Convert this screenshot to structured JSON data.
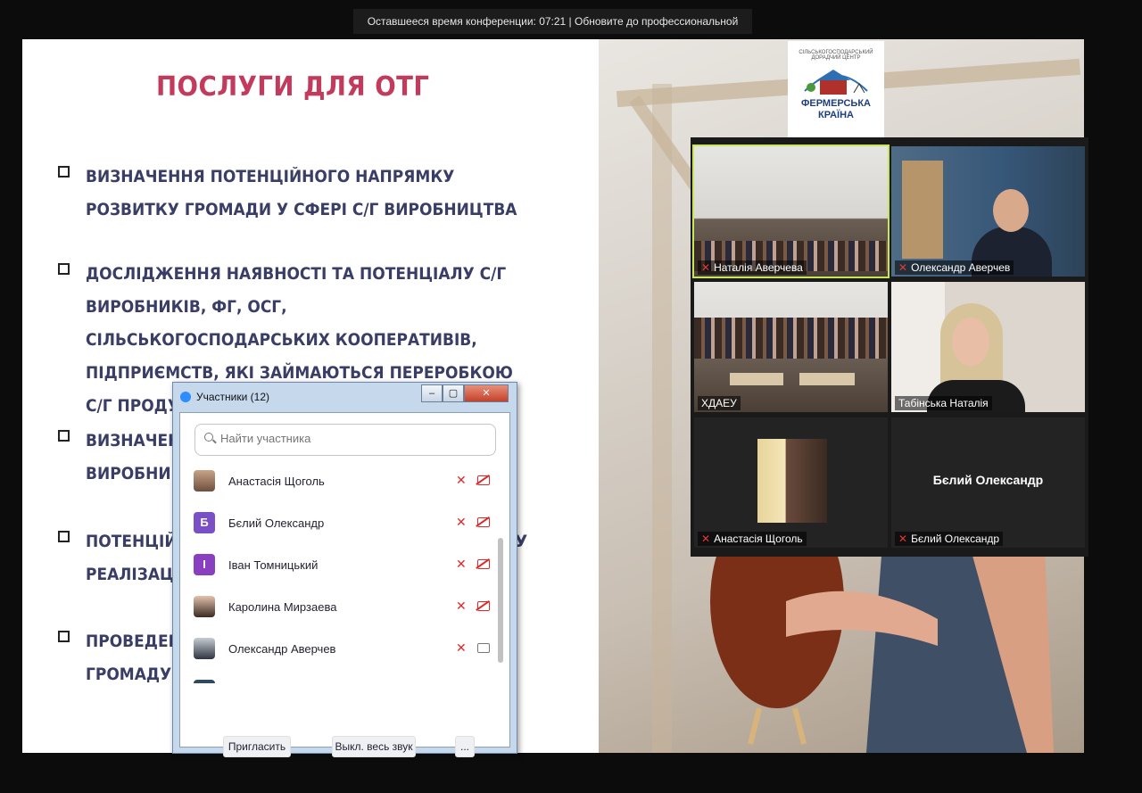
{
  "banner": "Оставшееся время конференции: 07:21 | Обновите до профессиональной версии",
  "slide": {
    "title": "ПОСЛУГИ ДЛЯ ОТГ",
    "bullets": [
      "ВИЗНАЧЕННЯ ПОТЕНЦІЙНОГО НАПРЯМКУ РОЗВИТКУ ГРОМАДИ У СФЕРІ С/Г ВИРОБНИЦТВА",
      "ДОСЛІДЖЕННЯ НАЯВНОСТІ ТА ПОТЕНЦІАЛУ С/Г ВИРОБНИКІВ, ФГ, ОСГ, СІЛЬСЬКОГОСПОДАРСЬКИХ КООПЕРАТИВІВ, ПІДПРИЄМСТВ, ЯКІ ЗАЙМАЮТЬСЯ ПЕРЕРОБКОЮ С/Г ПРОДУКЦІЇ, І Т.Д",
      "ВИЗНАЧЕН",
      "ВИРОБНИК",
      "ПОТЕНЦІЙ",
      "У",
      "РЕАЛІЗАЦІ",
      "ПРОВЕДЕН",
      "ГРОМАДУ Н"
    ],
    "logo": {
      "top_text": "СІЛЬСЬКОГОСПОДАРСЬКИЙ ДОРАДЧИЙ ЦЕНТР",
      "line1": "ФЕРМЕРСЬКА",
      "line2": "КРАЇНА"
    }
  },
  "video_tiles": [
    {
      "name": "Наталія Аверчева"
    },
    {
      "name": "Олександр Аверчев"
    },
    {
      "name": "ХДАЕУ"
    },
    {
      "name": "Табінська Наталія"
    },
    {
      "name": "Анастасія Щоголь"
    },
    {
      "name": "Бєлий Олександр",
      "center_name": "Бєлий Олександр"
    }
  ],
  "participants": {
    "title": "Участники (12)",
    "search_placeholder": "Найти участника",
    "items": [
      {
        "name": "Анастасія Щоголь",
        "initial": "",
        "camera_on": false
      },
      {
        "name": "Бєлий Олександр",
        "initial": "Б",
        "camera_on": false
      },
      {
        "name": "Іван Томницький",
        "initial": "І",
        "camera_on": false
      },
      {
        "name": "Каролина Мирзаева",
        "initial": "",
        "camera_on": false
      },
      {
        "name": "Олександр Аверчев",
        "initial": "",
        "camera_on": true
      }
    ],
    "invite_label": "Пригласить",
    "mute_all_label": "Выкл. весь звук",
    "more_label": "...",
    "window_buttons": {
      "minimize": "‒",
      "maximize": "▢",
      "close": "✕"
    }
  }
}
